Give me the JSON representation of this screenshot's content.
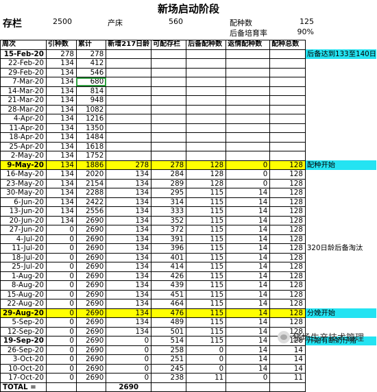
{
  "title": "新场启动阶段",
  "summary": {
    "cunlan_label": "存栏",
    "cunlan_value": "2500",
    "chanchuang_label": "产床",
    "chanchuang_value": "560",
    "peizhong_label": "配种数",
    "peizhong_value": "125",
    "houbei_label": "后备培育率",
    "houbei_value": "90%"
  },
  "columns": [
    "周次",
    "引种数",
    "累计",
    "新增217日龄",
    "可配存栏",
    "后备配种数",
    "返情配种数",
    "配种总数"
  ],
  "rows": [
    {
      "week": "15-Feb-20",
      "intro": "278",
      "cum": "278",
      "new217": "",
      "avail": "",
      "backup": "",
      "return": "",
      "total": "",
      "note": "后备达到133至140日",
      "bold": true,
      "cyan": true
    },
    {
      "week": "22-Feb-20",
      "intro": "134",
      "cum": "412",
      "new217": "",
      "avail": "",
      "backup": "",
      "return": "",
      "total": "",
      "note": ""
    },
    {
      "week": "29-Feb-20",
      "intro": "134",
      "cum": "546",
      "new217": "",
      "avail": "",
      "backup": "",
      "return": "",
      "total": "",
      "note": ""
    },
    {
      "week": "7-Mar-20",
      "intro": "134",
      "cum": "680",
      "new217": "",
      "avail": "",
      "backup": "",
      "return": "",
      "total": "",
      "note": "",
      "sel": true
    },
    {
      "week": "14-Mar-20",
      "intro": "134",
      "cum": "814",
      "new217": "",
      "avail": "",
      "backup": "",
      "return": "",
      "total": "",
      "note": ""
    },
    {
      "week": "21-Mar-20",
      "intro": "134",
      "cum": "948",
      "new217": "",
      "avail": "",
      "backup": "",
      "return": "",
      "total": "",
      "note": ""
    },
    {
      "week": "28-Mar-20",
      "intro": "134",
      "cum": "1082",
      "new217": "",
      "avail": "",
      "backup": "",
      "return": "",
      "total": "",
      "note": ""
    },
    {
      "week": "4-Apr-20",
      "intro": "134",
      "cum": "1216",
      "new217": "",
      "avail": "",
      "backup": "",
      "return": "",
      "total": "",
      "note": ""
    },
    {
      "week": "11-Apr-20",
      "intro": "134",
      "cum": "1350",
      "new217": "",
      "avail": "",
      "backup": "",
      "return": "",
      "total": "",
      "note": ""
    },
    {
      "week": "18-Apr-20",
      "intro": "134",
      "cum": "1484",
      "new217": "",
      "avail": "",
      "backup": "",
      "return": "",
      "total": "",
      "note": ""
    },
    {
      "week": "25-Apr-20",
      "intro": "134",
      "cum": "1618",
      "new217": "",
      "avail": "",
      "backup": "",
      "return": "",
      "total": "",
      "note": ""
    },
    {
      "week": "2-May-20",
      "intro": "134",
      "cum": "1752",
      "new217": "",
      "avail": "",
      "backup": "",
      "return": "",
      "total": "",
      "note": ""
    },
    {
      "week": "9-May-20",
      "intro": "134",
      "cum": "1886",
      "new217": "278",
      "avail": "278",
      "backup": "128",
      "return": "0",
      "total": "128",
      "note": "配种开始",
      "bold": true,
      "yellow": true,
      "cyan": true
    },
    {
      "week": "16-May-20",
      "intro": "134",
      "cum": "2020",
      "new217": "134",
      "avail": "284",
      "backup": "128",
      "return": "0",
      "total": "128",
      "note": ""
    },
    {
      "week": "23-May-20",
      "intro": "134",
      "cum": "2154",
      "new217": "134",
      "avail": "289",
      "backup": "128",
      "return": "0",
      "total": "128",
      "note": ""
    },
    {
      "week": "30-May-20",
      "intro": "134",
      "cum": "2288",
      "new217": "134",
      "avail": "295",
      "backup": "115",
      "return": "14",
      "total": "128",
      "note": ""
    },
    {
      "week": "6-Jun-20",
      "intro": "134",
      "cum": "2422",
      "new217": "134",
      "avail": "314",
      "backup": "115",
      "return": "14",
      "total": "128",
      "note": ""
    },
    {
      "week": "13-Jun-20",
      "intro": "134",
      "cum": "2556",
      "new217": "134",
      "avail": "333",
      "backup": "115",
      "return": "14",
      "total": "128",
      "note": ""
    },
    {
      "week": "20-Jun-20",
      "intro": "134",
      "cum": "2690",
      "new217": "134",
      "avail": "352",
      "backup": "115",
      "return": "14",
      "total": "128",
      "note": ""
    },
    {
      "week": "27-Jun-20",
      "intro": "0",
      "cum": "2690",
      "new217": "134",
      "avail": "372",
      "backup": "115",
      "return": "14",
      "total": "128",
      "note": ""
    },
    {
      "week": "4-Jul-20",
      "intro": "0",
      "cum": "2690",
      "new217": "134",
      "avail": "391",
      "backup": "115",
      "return": "14",
      "total": "128",
      "note": ""
    },
    {
      "week": "11-Jul-20",
      "intro": "0",
      "cum": "2690",
      "new217": "134",
      "avail": "396",
      "backup": "115",
      "return": "14",
      "total": "128",
      "note": "320日龄后备淘汰"
    },
    {
      "week": "18-Jul-20",
      "intro": "0",
      "cum": "2690",
      "new217": "134",
      "avail": "401",
      "backup": "115",
      "return": "14",
      "total": "128",
      "note": ""
    },
    {
      "week": "25-Jul-20",
      "intro": "0",
      "cum": "2690",
      "new217": "134",
      "avail": "414",
      "backup": "115",
      "return": "14",
      "total": "128",
      "note": ""
    },
    {
      "week": "1-Aug-20",
      "intro": "0",
      "cum": "2690",
      "new217": "134",
      "avail": "426",
      "backup": "115",
      "return": "14",
      "total": "128",
      "note": ""
    },
    {
      "week": "8-Aug-20",
      "intro": "0",
      "cum": "2690",
      "new217": "134",
      "avail": "439",
      "backup": "115",
      "return": "14",
      "total": "128",
      "note": ""
    },
    {
      "week": "15-Aug-20",
      "intro": "0",
      "cum": "2690",
      "new217": "134",
      "avail": "451",
      "backup": "115",
      "return": "14",
      "total": "128",
      "note": ""
    },
    {
      "week": "22-Aug-20",
      "intro": "0",
      "cum": "2690",
      "new217": "134",
      "avail": "464",
      "backup": "115",
      "return": "14",
      "total": "128",
      "note": ""
    },
    {
      "week": "29-Aug-20",
      "intro": "0",
      "cum": "2690",
      "new217": "134",
      "avail": "476",
      "backup": "115",
      "return": "14",
      "total": "128",
      "note": "分娩开始",
      "bold": true,
      "yellow": true,
      "cyan": true
    },
    {
      "week": "5-Sep-20",
      "intro": "0",
      "cum": "2690",
      "new217": "134",
      "avail": "489",
      "backup": "115",
      "return": "14",
      "total": "128",
      "note": ""
    },
    {
      "week": "12-Sep-20",
      "intro": "0",
      "cum": "2690",
      "new217": "134",
      "avail": "501",
      "backup": "115",
      "return": "14",
      "total": "128",
      "note": ""
    },
    {
      "week": "19-Sep-20",
      "intro": "0",
      "cum": "2690",
      "new217": "0",
      "avail": "514",
      "backup": "115",
      "return": "14",
      "total": "128",
      "note": "开始有断奶仔猪",
      "bold": true,
      "cyan": true
    },
    {
      "week": "26-Sep-20",
      "intro": "0",
      "cum": "2690",
      "new217": "0",
      "avail": "258",
      "backup": "0",
      "return": "14",
      "total": "14",
      "note": ""
    },
    {
      "week": "3-Oct-20",
      "intro": "0",
      "cum": "2690",
      "new217": "0",
      "avail": "251",
      "backup": "0",
      "return": "14",
      "total": "14",
      "note": ""
    },
    {
      "week": "10-Oct-20",
      "intro": "0",
      "cum": "2690",
      "new217": "0",
      "avail": "245",
      "backup": "0",
      "return": "14",
      "total": "14",
      "note": ""
    },
    {
      "week": "17-Oct-20",
      "intro": "0",
      "cum": "2690",
      "new217": "0",
      "avail": "238",
      "backup": "11",
      "return": "0",
      "total": "11",
      "note": ""
    }
  ],
  "total_row": {
    "label": "TOTAL =",
    "new217": "2690"
  },
  "watermark": "猪场生产技术管理",
  "colors": {
    "yellow": "#ffff00",
    "cyan": "#24e3f2",
    "selection": "#2e9e3f"
  }
}
